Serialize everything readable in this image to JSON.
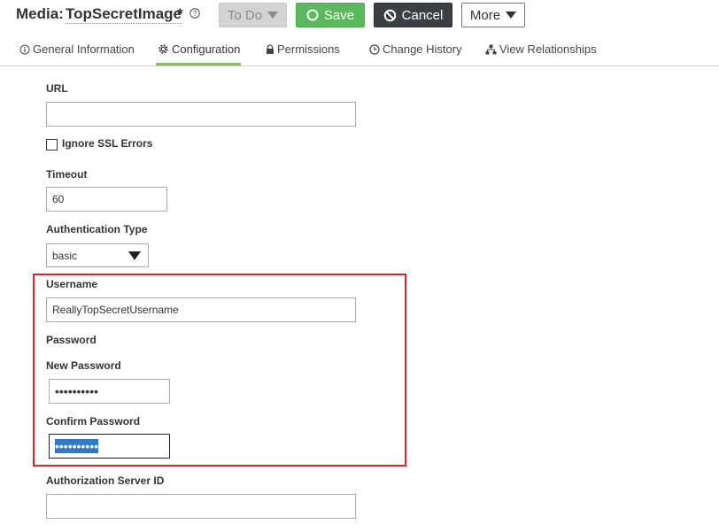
{
  "header": {
    "title_prefix": "Media:",
    "title_name": "TopSecretImage",
    "modified_marker": "*",
    "buttons": {
      "todo": "To Do",
      "save": "Save",
      "cancel": "Cancel",
      "more": "More"
    }
  },
  "tabs": [
    {
      "label": "General Information",
      "icon": "info-icon"
    },
    {
      "label": "Configuration",
      "icon": "gear-icon",
      "active": true
    },
    {
      "label": "Permissions",
      "icon": "lock-icon"
    },
    {
      "label": "Change History",
      "icon": "clock-icon"
    },
    {
      "label": "View Relationships",
      "icon": "hierarchy-icon"
    }
  ],
  "form": {
    "url_label": "URL",
    "url_value": "",
    "ignore_ssl_label": "Ignore SSL Errors",
    "ignore_ssl_checked": false,
    "timeout_label": "Timeout",
    "timeout_value": "60",
    "auth_type_label": "Authentication Type",
    "auth_type_value": "basic",
    "username_label": "Username",
    "username_value": "ReallyTopSecretUsername",
    "password_heading": "Password",
    "new_password_label": "New Password",
    "new_password_masked": "••••••••••",
    "confirm_password_label": "Confirm Password",
    "confirm_password_masked": "••••••••••",
    "auth_server_label": "Authorization Server ID",
    "auth_server_value": ""
  },
  "colors": {
    "save": "#5cb85c",
    "cancel": "#3a3f44",
    "active_tab": "#7fc15f",
    "highlight": "#d9262c",
    "selection": "#3178c6"
  }
}
